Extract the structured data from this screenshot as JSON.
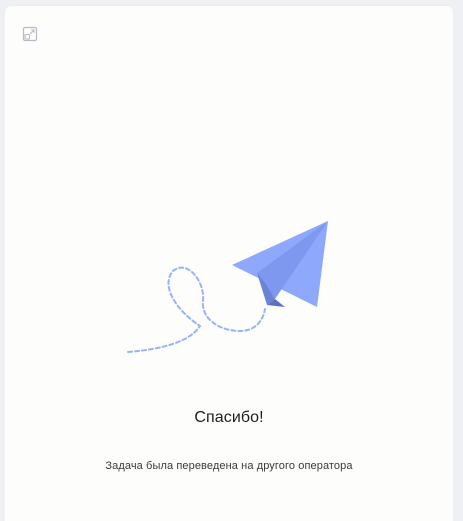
{
  "header": {
    "expand_icon": "expand-icon"
  },
  "illustration": {
    "icon": "paper-plane-icon",
    "plane_color": "#8ea8fb",
    "plane_shadow_color": "#6b83d6",
    "trail_color": "#9bb2f4"
  },
  "message": {
    "title": "Спасибо!",
    "subtitle": "Задача была переведена на другого оператора"
  }
}
